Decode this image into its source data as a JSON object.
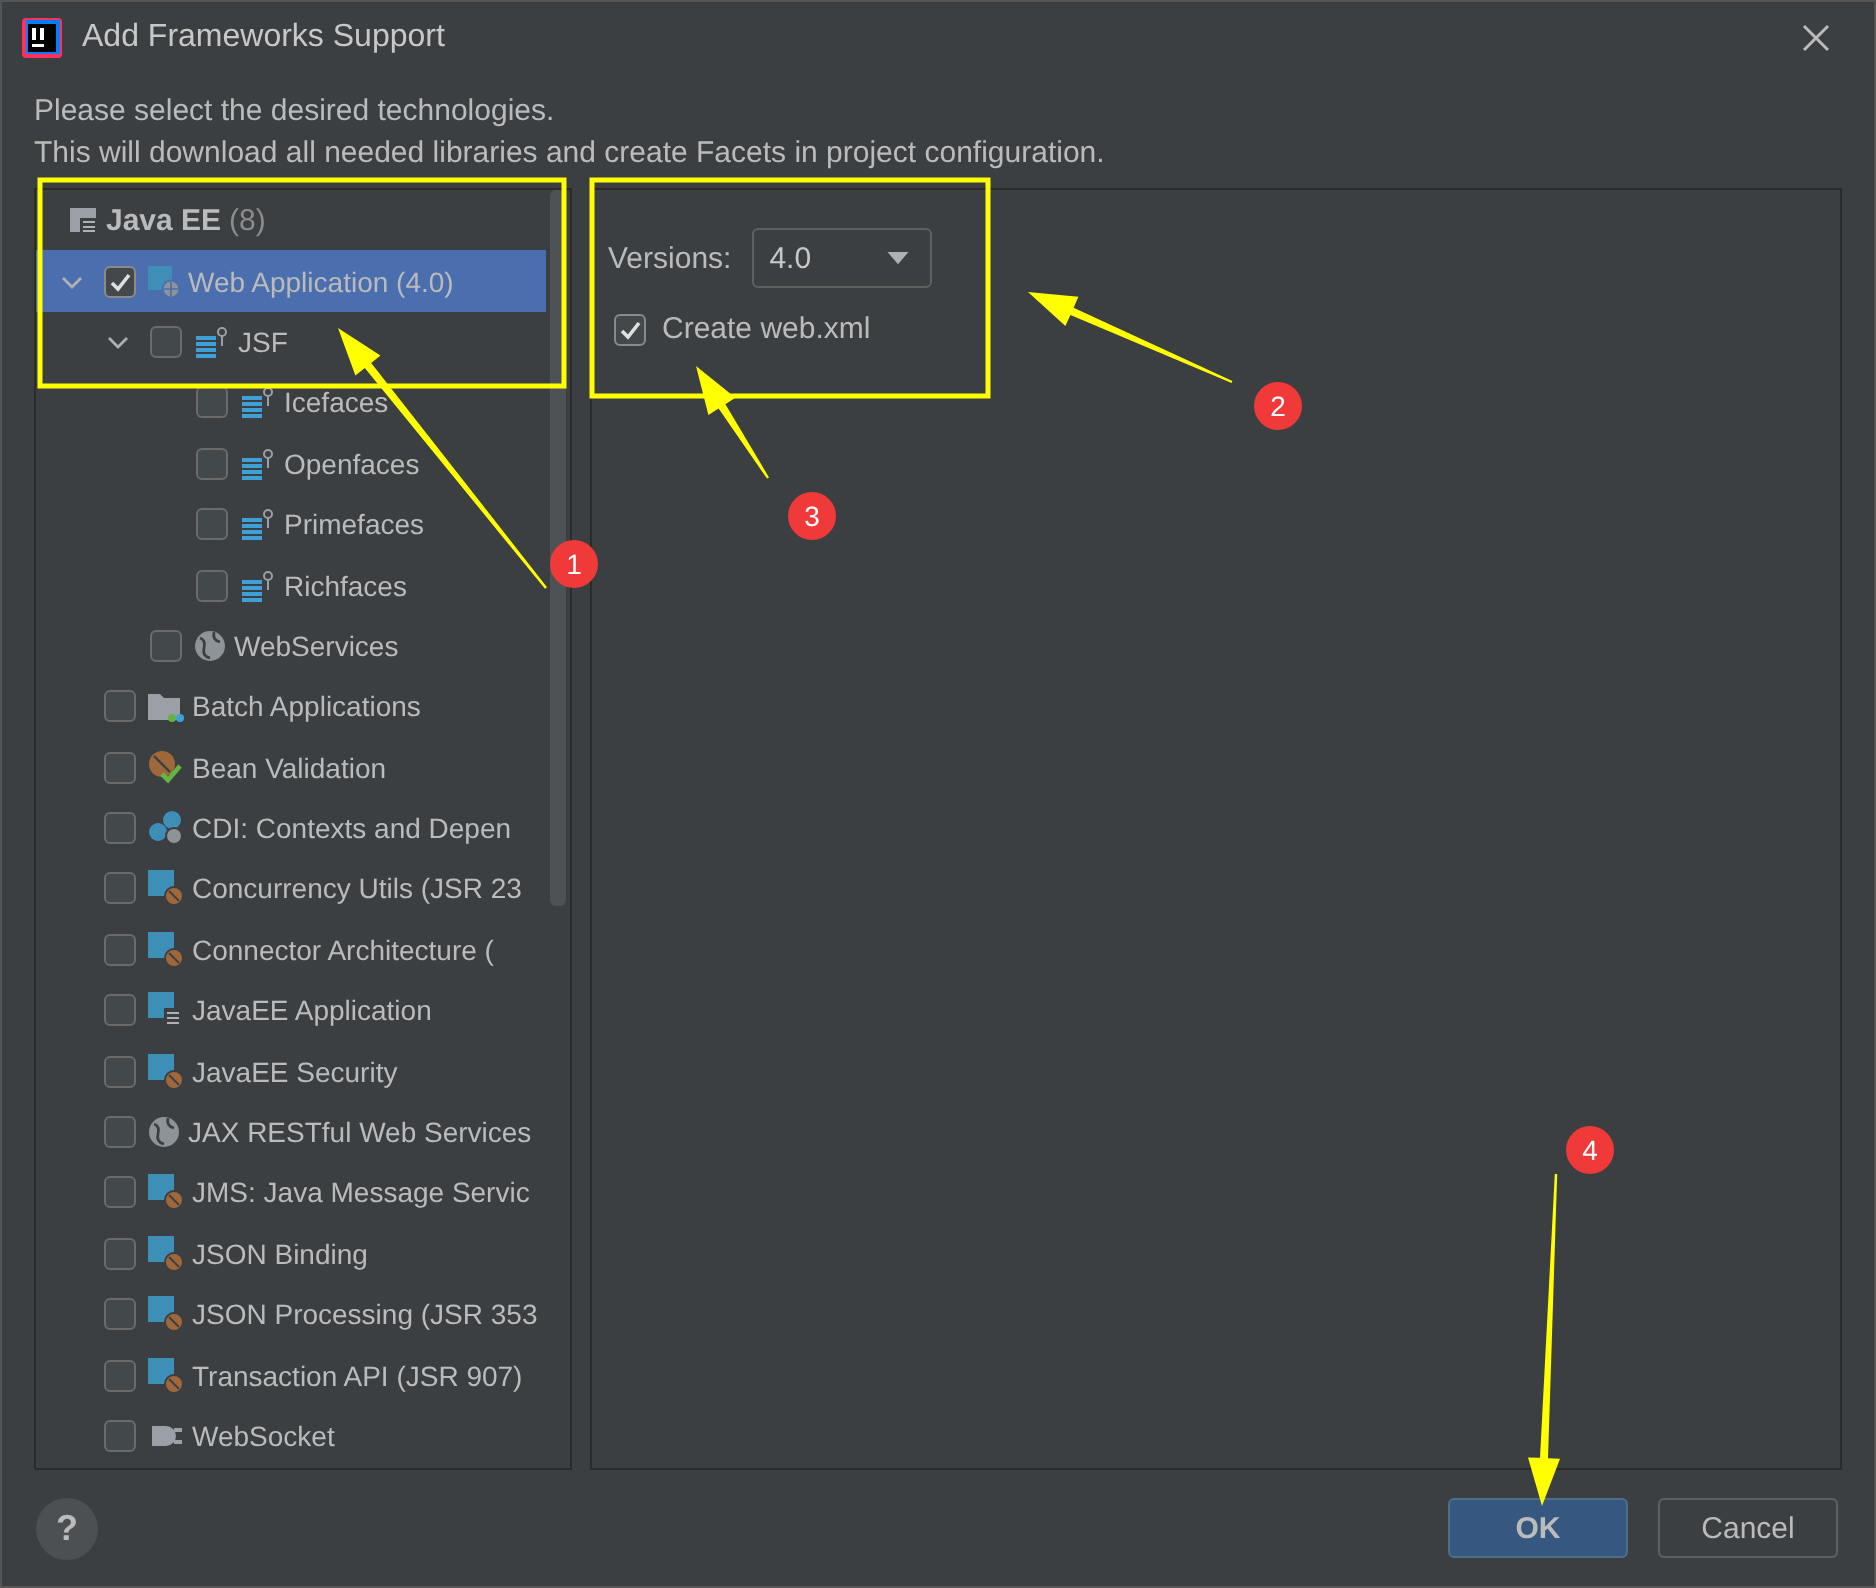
{
  "window": {
    "title": "Add Frameworks Support"
  },
  "instructions": [
    "Please select the desired technologies.",
    "This will download all needed libraries and create Facets in project configuration."
  ],
  "tree": {
    "group": {
      "label": "Java EE",
      "count": "(8)"
    },
    "items": [
      {
        "label": "Web Application (4.0)",
        "kind": "web",
        "checked": true,
        "selected": true,
        "expanded": true,
        "children": [
          {
            "label": "JSF",
            "kind": "jsf",
            "checked": false,
            "selected": false,
            "expanded": true,
            "children": [
              {
                "label": "Icefaces",
                "kind": "jsf",
                "checked": false,
                "selected": false
              },
              {
                "label": "Openfaces",
                "kind": "jsf",
                "checked": false,
                "selected": false
              },
              {
                "label": "Primefaces",
                "kind": "jsf",
                "checked": false,
                "selected": false
              },
              {
                "label": "Richfaces",
                "kind": "jsf",
                "checked": false,
                "selected": false
              }
            ]
          },
          {
            "label": "WebServices",
            "kind": "globe",
            "checked": false,
            "selected": false
          }
        ]
      },
      {
        "label": "Batch Applications",
        "kind": "folder",
        "checked": false,
        "selected": false
      },
      {
        "label": "Bean Validation",
        "kind": "bean",
        "checked": false,
        "selected": false
      },
      {
        "label": "CDI: Contexts and Depen",
        "kind": "cdi",
        "checked": false,
        "selected": false
      },
      {
        "label": "Concurrency Utils (JSR 23",
        "kind": "module",
        "checked": false,
        "selected": false
      },
      {
        "label": "Connector Architecture (",
        "kind": "module",
        "checked": false,
        "selected": false
      },
      {
        "label": "JavaEE Application",
        "kind": "javaee",
        "checked": false,
        "selected": false
      },
      {
        "label": "JavaEE Security",
        "kind": "module",
        "checked": false,
        "selected": false
      },
      {
        "label": "JAX RESTful Web Services",
        "kind": "globe",
        "checked": false,
        "selected": false
      },
      {
        "label": "JMS: Java Message Servic",
        "kind": "module",
        "checked": false,
        "selected": false
      },
      {
        "label": "JSON Binding",
        "kind": "module",
        "checked": false,
        "selected": false
      },
      {
        "label": "JSON Processing (JSR 353",
        "kind": "module",
        "checked": false,
        "selected": false
      },
      {
        "label": "Transaction API (JSR 907)",
        "kind": "module",
        "checked": false,
        "selected": false
      },
      {
        "label": "WebSocket",
        "kind": "socket",
        "checked": false,
        "selected": false
      }
    ]
  },
  "settings": {
    "versions_label": "Versions:",
    "version": "4.0",
    "create_web_xml": {
      "label": "Create web.xml",
      "checked": true
    }
  },
  "buttons": {
    "help": "?",
    "ok": "OK",
    "cancel": "Cancel"
  },
  "annotation_markers": [
    {
      "label": "1"
    },
    {
      "label": "2"
    },
    {
      "label": "3"
    },
    {
      "label": "4"
    }
  ]
}
